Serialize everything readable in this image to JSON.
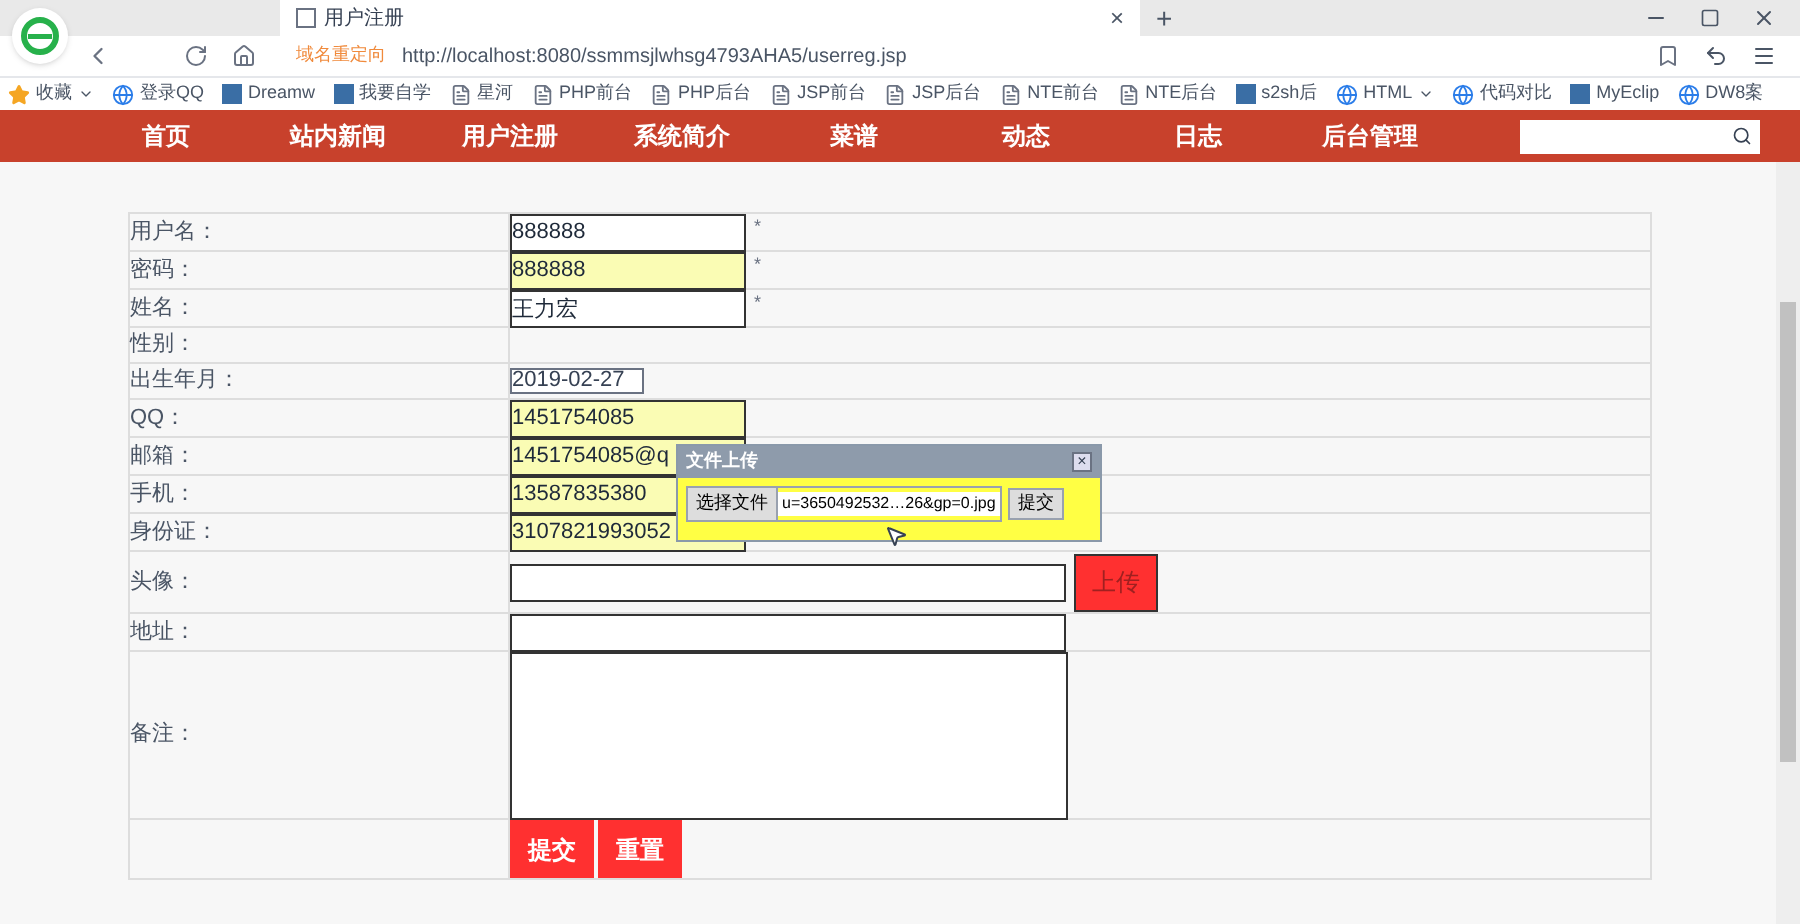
{
  "browser": {
    "tab": {
      "title": "用户注册",
      "close": "×"
    },
    "new_tab": "+",
    "redirect_label": "域名重定向",
    "url": "http://localhost:8080/ssmmsjlwhsg4793AHA5/userreg.jsp",
    "bookmarks": [
      {
        "label": "收藏",
        "kind": "star",
        "dropdown": true
      },
      {
        "label": "登录QQ",
        "kind": "globe",
        "dropdown": false
      },
      {
        "label": "Dreamw",
        "kind": "app",
        "dropdown": false
      },
      {
        "label": "我要自学",
        "kind": "app",
        "dropdown": false
      },
      {
        "label": "星河",
        "kind": "page",
        "dropdown": false
      },
      {
        "label": "PHP前台",
        "kind": "page",
        "dropdown": false
      },
      {
        "label": "PHP后台",
        "kind": "page",
        "dropdown": false
      },
      {
        "label": "JSP前台",
        "kind": "page",
        "dropdown": false
      },
      {
        "label": "JSP后台",
        "kind": "page",
        "dropdown": false
      },
      {
        "label": "NTE前台",
        "kind": "page",
        "dropdown": false
      },
      {
        "label": "NTE后台",
        "kind": "page",
        "dropdown": false
      },
      {
        "label": "s2sh后",
        "kind": "app",
        "dropdown": false
      },
      {
        "label": "HTML",
        "kind": "globe",
        "dropdown": true
      },
      {
        "label": "代码对比",
        "kind": "globe",
        "dropdown": false
      },
      {
        "label": "MyEclip",
        "kind": "app",
        "dropdown": false
      },
      {
        "label": "DW8案",
        "kind": "globe",
        "dropdown": false
      }
    ]
  },
  "nav": {
    "items": [
      {
        "label": "首页",
        "selected": false
      },
      {
        "label": "站内新闻",
        "selected": false
      },
      {
        "label": "用户注册",
        "selected": false
      },
      {
        "label": "系统简介",
        "selected": false
      },
      {
        "label": "菜谱",
        "selected": false
      },
      {
        "label": "动态",
        "selected": false
      },
      {
        "label": "日志",
        "selected": false
      },
      {
        "label": "后台管理",
        "selected": false
      }
    ]
  },
  "form": {
    "rows": [
      {
        "label": "用户名：",
        "kind": "text",
        "value": "888888",
        "highlighted": false,
        "required": "*"
      },
      {
        "label": "密码：",
        "kind": "text",
        "value": "888888",
        "highlighted": true,
        "required": "*"
      },
      {
        "label": "姓名：",
        "kind": "text",
        "value": "王力宏",
        "highlighted": false,
        "required": "*"
      },
      {
        "label": "性别：",
        "kind": "empty"
      },
      {
        "label": "出生年月：",
        "kind": "date",
        "value": "2019-02-27"
      },
      {
        "label": "QQ：",
        "kind": "text",
        "value": "1451754085",
        "highlighted": true
      },
      {
        "label": "邮箱：",
        "kind": "text",
        "value": "1451754085@q",
        "highlighted": true
      },
      {
        "label": "手机：",
        "kind": "text",
        "value": "13587835380",
        "highlighted": true
      },
      {
        "label": "身份证：",
        "kind": "text",
        "value": "3107821993052",
        "highlighted": true
      },
      {
        "label": "头像：",
        "kind": "upload",
        "button": "上传"
      },
      {
        "label": "地址：",
        "kind": "wide"
      },
      {
        "label": "备注：",
        "kind": "textarea"
      }
    ],
    "submit": "提交",
    "reset": "重置"
  },
  "upload_dialog": {
    "title": "文件上传",
    "close": "×",
    "choose": "选择文件",
    "filename": "u=3650492532…26&gp=0.jpg",
    "submit": "提交"
  }
}
